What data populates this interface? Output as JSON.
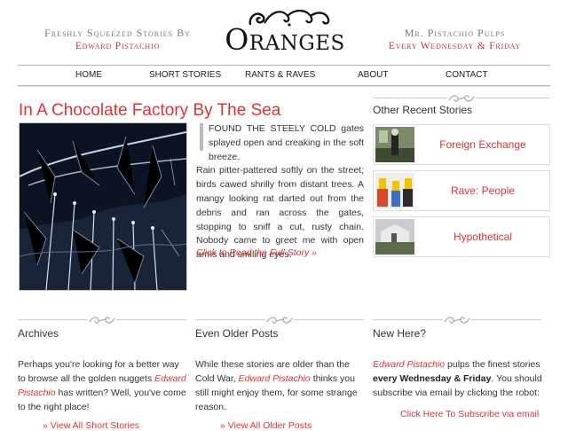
{
  "header": {
    "left_line1": "Freshly Squeezed Stories By",
    "left_line2": "Edward Pistachio",
    "logo_text": "Oranges",
    "right_line1": "Mr. Pistachio Pulps",
    "right_line2": "Every Wednesday & Friday"
  },
  "nav": {
    "items": [
      {
        "label": "HOME"
      },
      {
        "label": "SHORT STORIES"
      },
      {
        "label": "RANTS & RAVES"
      },
      {
        "label": "ABOUT"
      },
      {
        "label": "CONTACT"
      }
    ]
  },
  "featured": {
    "title": "In A Chocolate Factory By The Sea",
    "excerpt_first": "FOUND THE STEELY COLD gates splayed open and creaking in the soft breeze.",
    "excerpt_rest": "Rain pitter-pattered softly on the street; birds cawed shrilly from distant trees. A mangy looking rat darted out from the debris and ran across the gates, stopping to sniff a cut, rusty chain. Nobody came to greet me with open arms and smiling eyes.",
    "read_more": "Click to Read the Full Story »"
  },
  "sidebar": {
    "heading": "Other Recent Stories",
    "stories": [
      {
        "label": "Foreign Exchange"
      },
      {
        "label": "Rave: People"
      },
      {
        "label": "Hypothetical"
      }
    ]
  },
  "archives": {
    "heading": "Archives",
    "text_a": "Perhaps you're looking for a better way to browse all the golden nuggets",
    "author": "Edward Pistachio",
    "text_b": "has written? Well, you've come to the right place!",
    "link": "View All Short Stories"
  },
  "older": {
    "heading": "Even Older Posts",
    "text_a": "While these stories are older than the Cold War,",
    "author": "Edward Pistachio",
    "text_b": "thinks you still might enjoy them, for some strange reason.",
    "link": "View All Older Posts"
  },
  "newhere": {
    "heading": "New Here?",
    "author": "Edward Pistachio",
    "text_a": "pulps the finest stories",
    "bold": "every Wednesday & Friday",
    "text_b": ". You should subscribe via email by clicking the robot:",
    "subscribe": "Click Here To Subscribe via email"
  },
  "colors": {
    "accent": "#dd3333",
    "text": "#333333",
    "rule": "#bbbbbb"
  }
}
